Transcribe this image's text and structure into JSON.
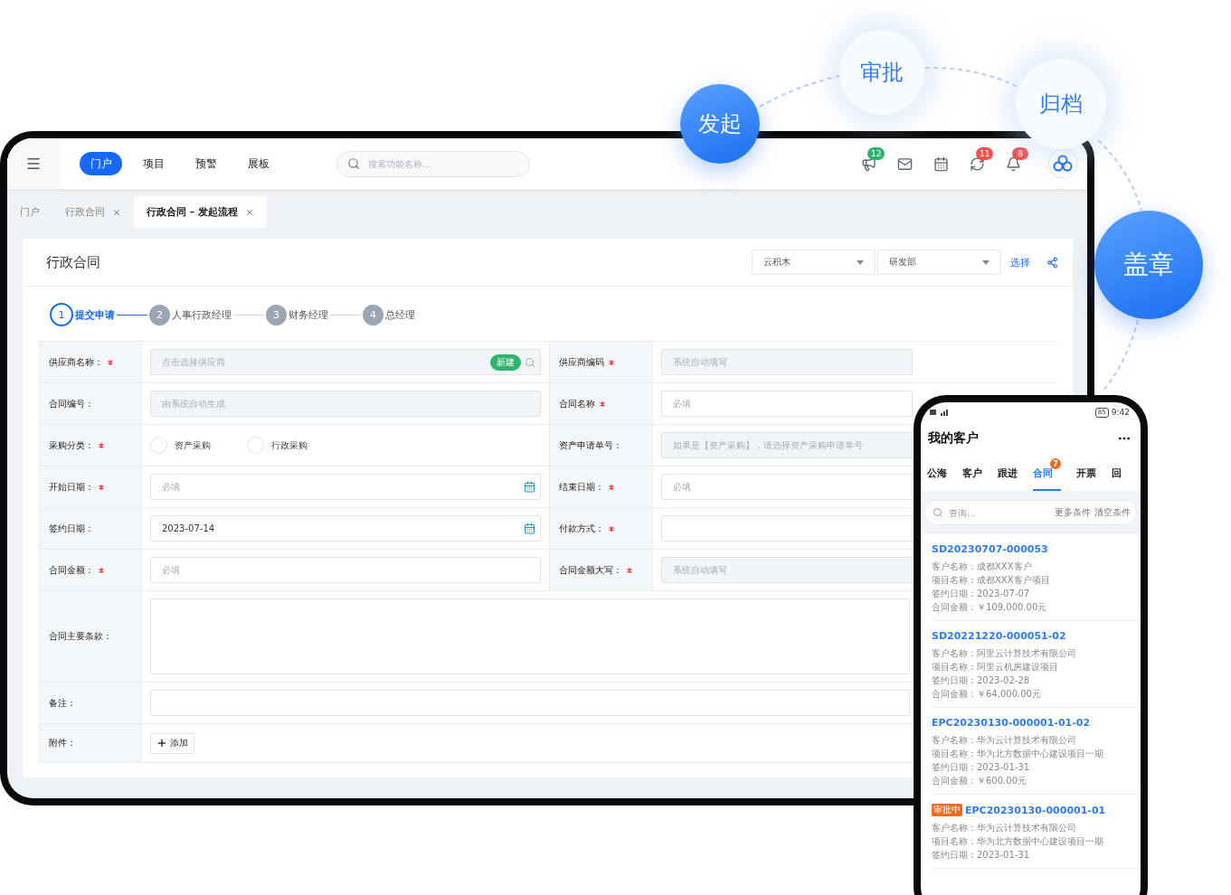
{
  "flow_steps": [
    {
      "label": "发起",
      "kind": "primary"
    },
    {
      "label": "审批",
      "kind": "light"
    },
    {
      "label": "归档",
      "kind": "light"
    },
    {
      "label": "盖章",
      "kind": "primary"
    }
  ],
  "tablet": {
    "nav": [
      {
        "label": "门户",
        "selected": true
      },
      {
        "label": "项目",
        "selected": false
      },
      {
        "label": "预警",
        "selected": false
      },
      {
        "label": "展板",
        "selected": false
      }
    ],
    "search": {
      "placeholder": "搜索功能名称..."
    },
    "notifications": [
      {
        "kind": "megaphone",
        "count": "12",
        "color": "#2fb36e"
      },
      {
        "kind": "mail"
      },
      {
        "kind": "calendar"
      },
      {
        "kind": "refresh",
        "count": "11",
        "color": "#f0524f"
      },
      {
        "kind": "bell",
        "count": "8",
        "color": "#f0524f"
      }
    ],
    "tabs": [
      {
        "label": "门户",
        "selected": false,
        "closable": false
      },
      {
        "label": "行政合同",
        "selected": false,
        "closable": true
      },
      {
        "label": "行政合同 – 发起流程",
        "selected": true,
        "closable": true
      }
    ],
    "form_title": "行政合同",
    "selects": [
      "云积木",
      "研发部"
    ],
    "select_link": "选择",
    "steps": [
      {
        "number": "1",
        "label": "提交申请",
        "selected": true
      },
      {
        "number": "2",
        "label": "人事行政经理",
        "selected": false
      },
      {
        "number": "3",
        "label": "财务经理",
        "selected": false
      },
      {
        "number": "4",
        "label": "总经理",
        "selected": false
      }
    ],
    "rows": [
      {
        "kind": "pair",
        "fields": [
          {
            "label": "供应商名称：",
            "required": true,
            "kind": "lookup",
            "placeholder": "点击选择供应商",
            "readonly": true,
            "tag": "新建"
          },
          {
            "label": "供应商编码",
            "required": true,
            "kind": "text",
            "placeholder": "系统自动填写",
            "readonly": true
          }
        ]
      },
      {
        "kind": "pair",
        "fields": [
          {
            "label": "合同编号：",
            "required": false,
            "kind": "text",
            "placeholder": "由系统自动生成",
            "readonly": true
          },
          {
            "label": "合同名称",
            "required": true,
            "kind": "text",
            "placeholder": "必填",
            "readonly": false
          }
        ]
      },
      {
        "kind": "pair",
        "fields": [
          {
            "label": "采购分类：",
            "required": true,
            "kind": "radio",
            "options": [
              {
                "label": "资产采购",
                "checked": false
              },
              {
                "label": "行政采购",
                "checked": false
              }
            ]
          },
          {
            "label": "资产申请单号：",
            "required": false,
            "kind": "text",
            "placeholder": "如果是【资产采购】，请选择资产采购申请单号",
            "readonly": true
          }
        ]
      },
      {
        "kind": "pair",
        "fields": [
          {
            "label": "开始日期：",
            "required": true,
            "kind": "date",
            "placeholder": "必填",
            "readonly": false
          },
          {
            "label": "结束日期：",
            "required": true,
            "kind": "text",
            "placeholder": "必填",
            "readonly": false
          }
        ]
      },
      {
        "kind": "pair",
        "fields": [
          {
            "label": "签约日期：",
            "required": false,
            "kind": "date",
            "value": "2023-07-14",
            "readonly": false
          },
          {
            "label": "付款方式：",
            "required": true,
            "kind": "text",
            "readonly": false
          }
        ]
      },
      {
        "kind": "pair",
        "fields": [
          {
            "label": "合同金额：",
            "required": true,
            "kind": "text",
            "placeholder": "必填",
            "readonly": false
          },
          {
            "label": "合同金额大写：",
            "required": true,
            "kind": "text",
            "placeholder": "系统自动填写",
            "readonly": true
          }
        ]
      },
      {
        "kind": "full",
        "fields": [
          {
            "label": "合同主要条款：",
            "required": false,
            "kind": "textarea",
            "readonly": false
          }
        ]
      },
      {
        "kind": "full",
        "fields": [
          {
            "label": "备注：",
            "required": false,
            "kind": "text",
            "readonly": false
          }
        ]
      },
      {
        "kind": "full",
        "fields": [
          {
            "label": "附件：",
            "required": false,
            "kind": "upload",
            "button": "添加"
          }
        ]
      }
    ]
  },
  "phone": {
    "time": "9:42",
    "battery": "85",
    "title": "我的客户",
    "tabs": [
      {
        "label": "公海",
        "selected": false
      },
      {
        "label": "客户",
        "selected": false
      },
      {
        "label": "跟进",
        "selected": false
      },
      {
        "label": "合同",
        "selected": true,
        "badge": "7"
      },
      {
        "label": "开票",
        "selected": false
      },
      {
        "label": "回",
        "selected": false
      }
    ],
    "search": {
      "placeholder": "查询...",
      "links": [
        "更多条件",
        "清空条件"
      ]
    },
    "cards": [
      {
        "code": "SD20230707-000053",
        "lines": [
          "客户名称：成都XXX客户",
          "项目名称：成都XXX客户项目",
          "签约日期：2023-07-07",
          "合同金额：￥109,000.00元"
        ]
      },
      {
        "code": "SD20221220-000051-02",
        "lines": [
          "客户名称：阿里云计算技术有限公司",
          "项目名称：阿里云机房建设项目",
          "签约日期：2023-02-28",
          "合同金额：￥64,000.00元"
        ]
      },
      {
        "code": "EPC20230130-000001-01-02",
        "lines": [
          "客户名称：华为云计算技术有限公司",
          "项目名称：华为北方数据中心建设项目一期",
          "签约日期：2023-01-31",
          "合同金额：￥600.00元"
        ]
      },
      {
        "code": "EPC20230130-000001-01",
        "status": "审批中",
        "lines": [
          "客户名称：华为云计算技术有限公司",
          "项目名称：华为北方数据中心建设项目一期",
          "签约日期：2023-01-31"
        ]
      }
    ]
  }
}
